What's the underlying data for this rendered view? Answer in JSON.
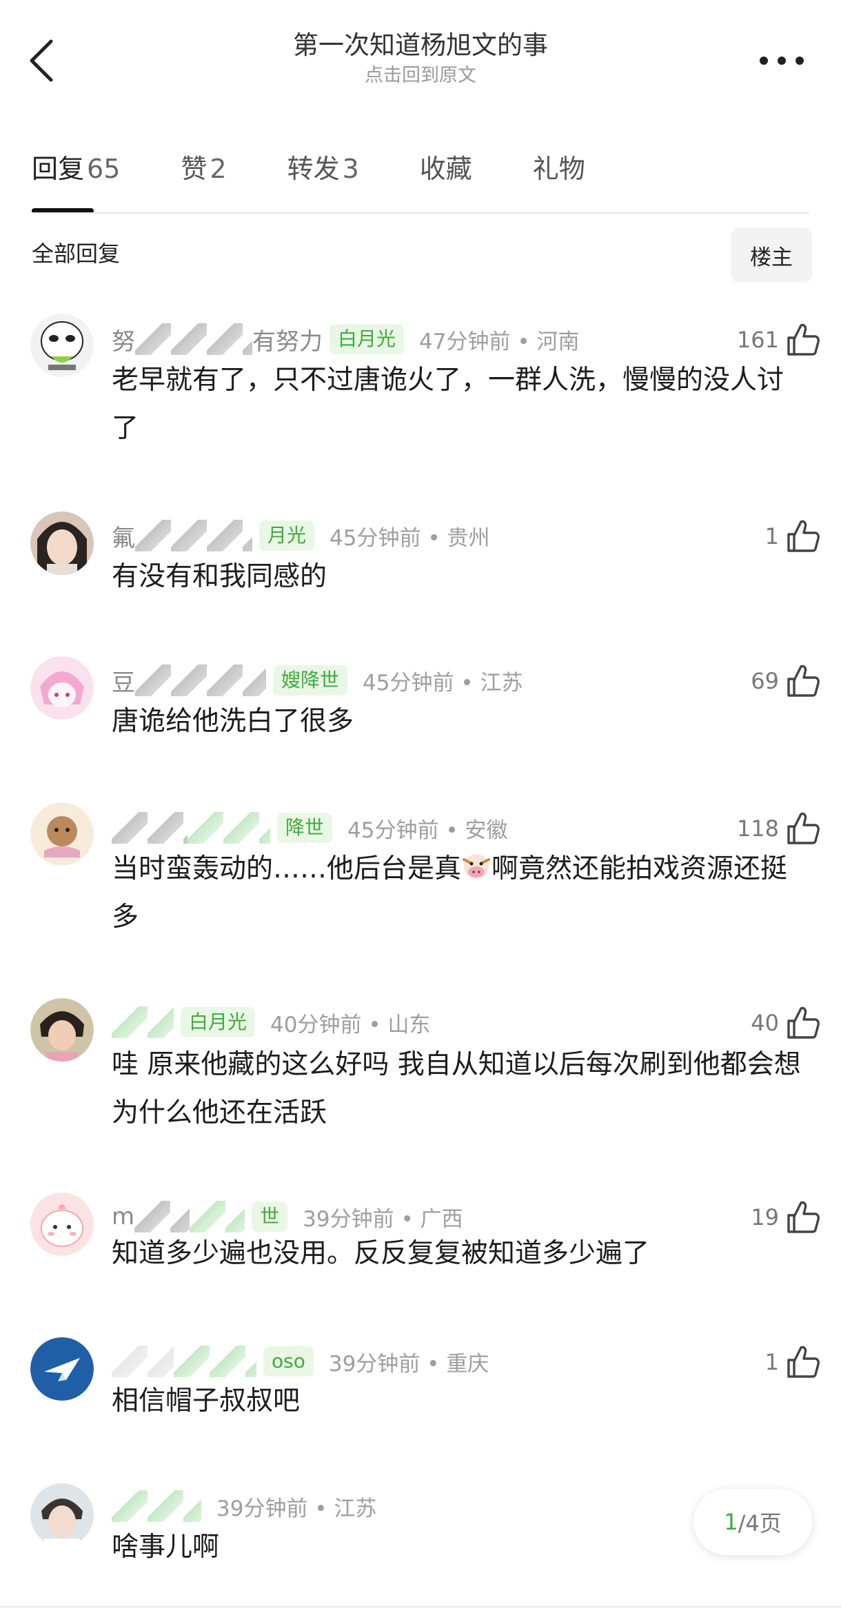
{
  "header": {
    "title": "第一次知道杨旭文的事",
    "subtitle": "点击回到原文"
  },
  "tabs": [
    {
      "label": "回复",
      "count": "65"
    },
    {
      "label": "赞",
      "count": "2"
    },
    {
      "label": "转发",
      "count": "3"
    },
    {
      "label": "收藏",
      "count": ""
    },
    {
      "label": "礼物",
      "count": ""
    }
  ],
  "filter": {
    "all_replies": "全部回复",
    "op_only": "楼主"
  },
  "comments": [
    {
      "username": "努",
      "username_tail": "有努力",
      "badge": "白月光",
      "time": "47分钟前",
      "location": "河南",
      "likes": "161",
      "text": "老早就有了，只不过唐诡火了，一群人洗，慢慢的没人讨了"
    },
    {
      "username": "氟",
      "badge": "月光",
      "time": "45分钟前",
      "location": "贵州",
      "likes": "1",
      "text": "有没有和我同感的"
    },
    {
      "username": "豆",
      "badge": "嫂降世",
      "time": "45分钟前",
      "location": "江苏",
      "likes": "69",
      "text": "唐诡给他洗白了很多"
    },
    {
      "username": "",
      "badge": "降世",
      "time": "45分钟前",
      "location": "安徽",
      "likes": "118",
      "text_a": "当时蛮轰动的……他后台是真",
      "text_b": "啊竟然还能拍戏资源还挺多"
    },
    {
      "username": "",
      "badge": "白月光",
      "time": "40分钟前",
      "location": "山东",
      "likes": "40",
      "text": "哇 原来他藏的这么好吗 我自从知道以后每次刷到他都会想为什么他还在活跃"
    },
    {
      "username": "m",
      "badge": "世",
      "time": "39分钟前",
      "location": "广西",
      "likes": "19",
      "text": "知道多少遍也没用。反反复复被知道多少遍了"
    },
    {
      "username": "",
      "badge": "oso",
      "time": "39分钟前",
      "location": "重庆",
      "likes": "1",
      "text": "相信帽子叔叔吧"
    },
    {
      "username": "",
      "badge": "",
      "time": "39分钟前",
      "location": "江苏",
      "likes": "",
      "text": "啥事儿啊"
    }
  ],
  "pager": {
    "current": "1",
    "rest": "/4页"
  },
  "colors": {
    "accent_green": "#3fab3c",
    "badge_bg": "#eaf7e6"
  }
}
